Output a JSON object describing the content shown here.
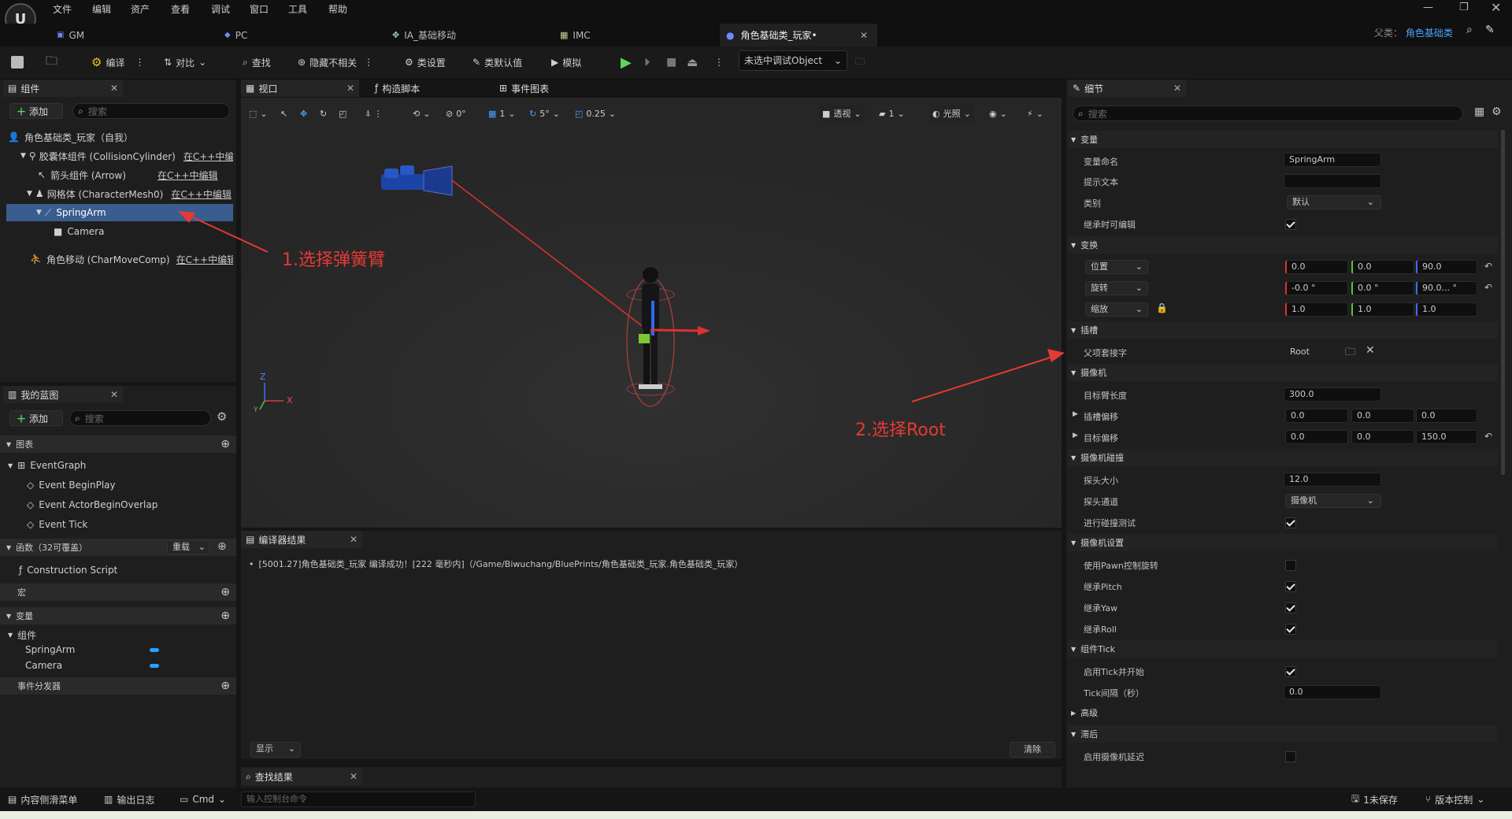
{
  "menu": [
    "文件",
    "编辑",
    "资产",
    "查看",
    "调试",
    "窗口",
    "工具",
    "帮助"
  ],
  "doc_tabs": [
    "GM",
    "PC",
    "IA_基础移动",
    "IMC",
    "角色基础类_玩家•"
  ],
  "parent_class": {
    "label": "父类：",
    "value": "角色基础类"
  },
  "toolbar": {
    "compile": "编译",
    "diff": "对比",
    "find": "查找",
    "hide_unrelated": "隐藏不相关",
    "class_settings": "类设置",
    "class_defaults": "类默认值",
    "simulate": "模拟",
    "debug_object": "未选中调试Object"
  },
  "components_panel": {
    "title": "组件",
    "add": "添加",
    "search_placeholder": "搜索",
    "tree": [
      {
        "label": "角色基础类_玩家（自我）",
        "link": ""
      },
      {
        "label": "胶囊体组件 (CollisionCylinder)",
        "link": "在C++中编"
      },
      {
        "label": "箭头组件 (Arrow)",
        "link": "在C++中编辑"
      },
      {
        "label": "网格体 (CharacterMesh0)",
        "link": "在C++中编辑"
      },
      {
        "label": "SpringArm",
        "link": ""
      },
      {
        "label": "Camera",
        "link": ""
      },
      {
        "label": "角色移动 (CharMoveComp)",
        "link": "在C++中编辑"
      }
    ]
  },
  "my_blueprint": {
    "title": "我的蓝图",
    "add": "添加",
    "search_placeholder": "搜索",
    "graphs_header": "图表",
    "event_graph": "EventGraph",
    "events": [
      "Event BeginPlay",
      "Event ActorBeginOverlap",
      "Event Tick"
    ],
    "functions_header": "函数（32可覆盖）",
    "override": "重载",
    "construction_script": "Construction Script",
    "macros_header": "宏",
    "variables_header": "变量",
    "components_header": "组件",
    "component_vars": [
      "SpringArm",
      "Camera"
    ],
    "dispatchers_header": "事件分发器"
  },
  "center_tabs": {
    "viewport": "视口",
    "construction": "构造脚本",
    "event_graph": "事件图表"
  },
  "viewport_toolbar": {
    "rot_snap": "0°",
    "grid_snap": "1",
    "angle_snap": "5°",
    "scale_snap": "0.25",
    "perspective": "透视",
    "speed": "1",
    "lighting": "光照"
  },
  "annotations": {
    "step1": "1.选择弹簧臂",
    "step2": "2.选择Root"
  },
  "axes": {
    "z": "Z",
    "x": "X",
    "y": "Y"
  },
  "compiler": {
    "title": "编译器结果",
    "message": "[5001.27]角色基础类_玩家 编译成功！[222 毫秒内]（/Game/Biwuchang/BluePrints/角色基础类_玩家.角色基础类_玩家）",
    "show": "显示",
    "clear": "清除"
  },
  "find_results": {
    "title": "查找结果"
  },
  "details": {
    "title": "细节",
    "search_placeholder": "搜索",
    "sec_variable": "变量",
    "var_name_label": "变量命名",
    "var_name": "SpringArm",
    "tooltip_label": "提示文本",
    "category_label": "类别",
    "category": "默认",
    "editable_label": "继承时可编辑",
    "sec_transform": "变换",
    "location_label": "位置",
    "location": [
      "0.0",
      "0.0",
      "90.0"
    ],
    "rotation_label": "旋转",
    "rotation": [
      "-0.0 °",
      "0.0 °",
      "90.0... °"
    ],
    "scale_label": "缩放",
    "scale": [
      "1.0",
      "1.0",
      "1.0"
    ],
    "sec_socket": "插槽",
    "parent_socket_label": "父项套接字",
    "parent_socket": "Root",
    "sec_camera": "摄像机",
    "arm_length_label": "目标臂长度",
    "arm_length": "300.0",
    "socket_offset_label": "插槽偏移",
    "socket_offset": [
      "0.0",
      "0.0",
      "0.0"
    ],
    "target_offset_label": "目标偏移",
    "target_offset": [
      "0.0",
      "0.0",
      "150.0"
    ],
    "sec_collision": "摄像机碰撞",
    "probe_size_label": "探头大小",
    "probe_size": "12.0",
    "probe_channel_label": "探头通道",
    "probe_channel": "摄像机",
    "do_collision_label": "进行碰撞测试",
    "sec_camera_settings": "摄像机设置",
    "use_pawn_label": "使用Pawn控制旋转",
    "pitch_label": "继承Pitch",
    "yaw_label": "继承Yaw",
    "roll_label": "继承Roll",
    "sec_tick": "组件Tick",
    "start_tick_label": "启用Tick并开始",
    "tick_interval_label": "Tick间隔（秒）",
    "tick_interval": "0.0",
    "sec_advanced": "高级",
    "sec_lag": "滞后",
    "camera_lag_label": "启用摄像机延迟"
  },
  "status": {
    "content_drawer": "内容侧滑菜单",
    "output_log": "输出日志",
    "cmd": "Cmd",
    "console_placeholder": "输入控制台命令",
    "unsaved": "1未保存",
    "source_control": "版本控制"
  }
}
